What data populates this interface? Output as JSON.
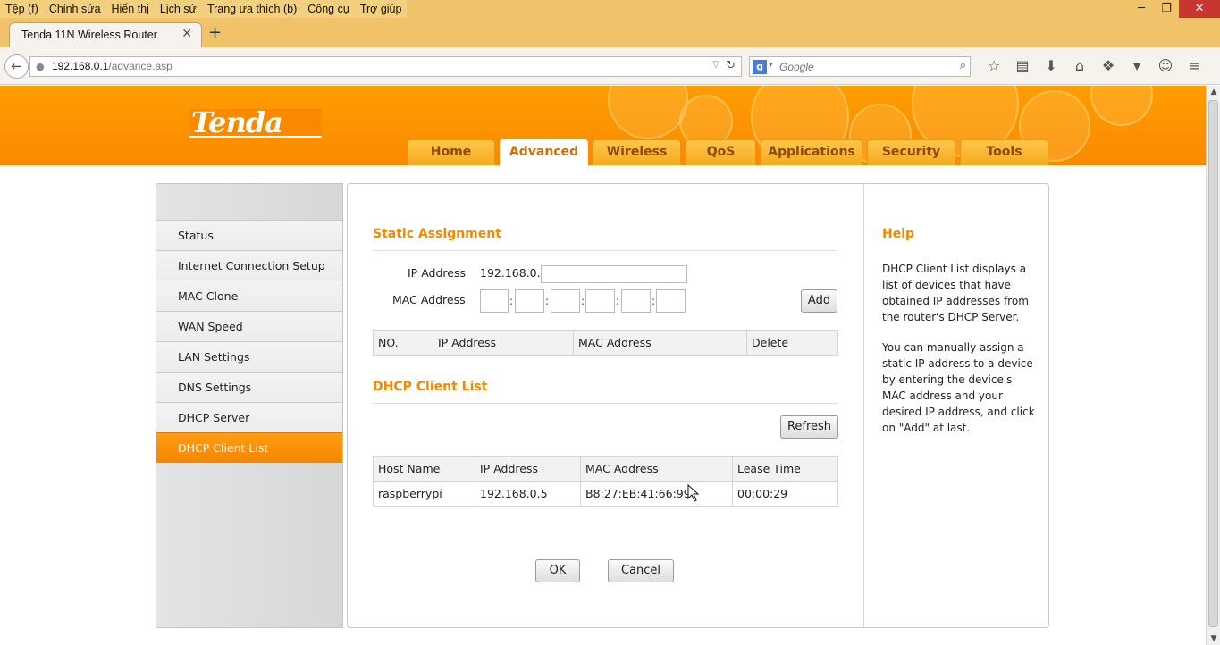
{
  "browser": {
    "menu": [
      "Tệp (f)",
      "Chỉnh sửa",
      "Hiển thị",
      "Lịch sử",
      "Trang ưa thích (b)",
      "Công cụ",
      "Trợ giúp"
    ],
    "window_controls": {
      "minimize": "─",
      "restore": "❐",
      "close": "✕"
    },
    "tab_title": "Tenda 11N Wireless Router",
    "tab_close": "✕",
    "new_tab": "+",
    "url_host": "192.168.0.1",
    "url_path": "/advance.asp",
    "search_placeholder": "Google",
    "icons": [
      "star-icon",
      "reading-list-icon",
      "download-icon",
      "home-icon",
      "extension-icon",
      "dropdown-icon",
      "chat-icon",
      "menu-icon"
    ]
  },
  "header": {
    "logo": "Tenda",
    "nav_tabs": [
      {
        "label": "Home",
        "active": false
      },
      {
        "label": "Advanced",
        "active": true
      },
      {
        "label": "Wireless",
        "active": false
      },
      {
        "label": "QoS",
        "active": false
      },
      {
        "label": "Applications",
        "active": false
      },
      {
        "label": "Security",
        "active": false
      },
      {
        "label": "Tools",
        "active": false
      }
    ]
  },
  "sidebar": {
    "items": [
      {
        "label": "Status",
        "active": false
      },
      {
        "label": "Internet Connection Setup",
        "active": false
      },
      {
        "label": "MAC Clone",
        "active": false
      },
      {
        "label": "WAN Speed",
        "active": false
      },
      {
        "label": "LAN Settings",
        "active": false
      },
      {
        "label": "DNS Settings",
        "active": false
      },
      {
        "label": "DHCP Server",
        "active": false
      },
      {
        "label": "DHCP Client List",
        "active": true
      }
    ]
  },
  "static_assignment": {
    "title": "Static Assignment",
    "ip_label": "IP Address",
    "ip_prefix": "192.168.0.",
    "ip_value": "",
    "mac_label": "MAC Address",
    "mac_values": [
      "",
      "",
      "",
      "",
      "",
      ""
    ],
    "mac_separator": ":",
    "add_button": "Add",
    "table_headers": [
      "NO.",
      "IP Address",
      "MAC Address",
      "Delete"
    ]
  },
  "dhcp_client_list": {
    "title": "DHCP Client List",
    "refresh_button": "Refresh",
    "table_headers": [
      "Host Name",
      "IP Address",
      "MAC Address",
      "Lease Time"
    ],
    "rows": [
      {
        "host": "raspberrypi",
        "ip": "192.168.0.5",
        "mac": "B8:27:EB:41:66:99",
        "lease": "00:00:29"
      }
    ]
  },
  "actions": {
    "ok": "OK",
    "cancel": "Cancel"
  },
  "help": {
    "title": "Help",
    "paragraphs": [
      "DHCP Client List displays a list of devices that have obtained IP addresses from the router's DHCP Server.",
      "You can manually assign a static IP address to a device by entering the device's MAC address and your desired IP address, and click on \"Add\" at last."
    ]
  },
  "colors": {
    "accent": "#f98a00",
    "title": "#f08a00",
    "active_tab_text": "#d46d00"
  }
}
